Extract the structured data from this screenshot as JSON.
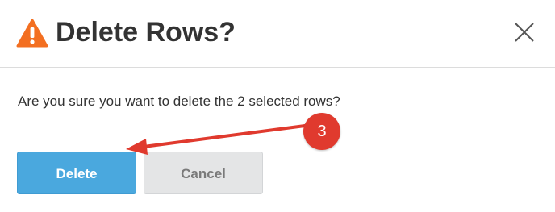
{
  "dialog": {
    "title": "Delete Rows?",
    "message": "Are you sure you want to delete the 2 selected rows?",
    "delete_label": "Delete",
    "cancel_label": "Cancel",
    "icons": {
      "warning": "warning-triangle-icon",
      "close": "close-x-icon"
    }
  },
  "annotation": {
    "step_number": "3"
  },
  "colors": {
    "warning": "#f36f21",
    "primary_button": "#4aa8de",
    "secondary_button": "#e4e5e6",
    "annotation": "#e03a2e"
  }
}
